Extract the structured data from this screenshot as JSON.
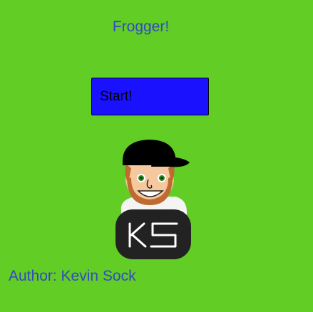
{
  "game": {
    "title": "Frogger!",
    "start_label": "Start!",
    "author": "Author: Kevin Sock",
    "avatar_badge_text": "KS"
  },
  "colors": {
    "background": "#62cd25",
    "text": "#3448c4",
    "start_button": "#1a12ff",
    "badge": "#222222",
    "cap": "#000000",
    "skin": "#f5c99d",
    "hair": "#c06a33",
    "eyes": "#2a8a2a"
  },
  "icons": {
    "avatar": "cartoon-face-with-cap-icon",
    "badge": "initials-badge-icon"
  }
}
